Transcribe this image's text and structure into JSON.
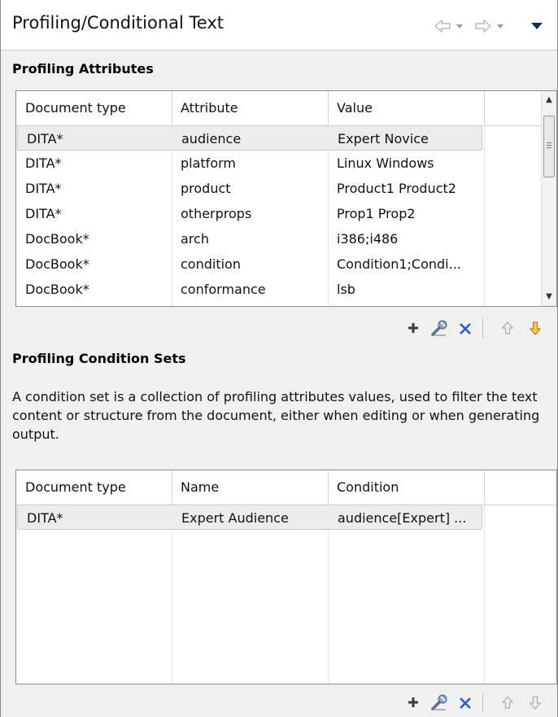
{
  "panel": {
    "title": "Profiling/Conditional Text"
  },
  "profiling_attributes": {
    "section_title": "Profiling Attributes",
    "columns": [
      "Document type",
      "Attribute",
      "Value"
    ],
    "rows": [
      {
        "doc_type": "DITA*",
        "attribute": "audience",
        "value": "Expert Novice",
        "selected": true
      },
      {
        "doc_type": "DITA*",
        "attribute": "platform",
        "value": "Linux Windows"
      },
      {
        "doc_type": "DITA*",
        "attribute": "product",
        "value": "Product1 Product2"
      },
      {
        "doc_type": "DITA*",
        "attribute": "otherprops",
        "value": "Prop1 Prop2"
      },
      {
        "doc_type": "DocBook*",
        "attribute": "arch",
        "value": "i386;i486"
      },
      {
        "doc_type": "DocBook*",
        "attribute": "condition",
        "value": "Condition1;Condi..."
      },
      {
        "doc_type": "DocBook*",
        "attribute": "conformance",
        "value": "lsb"
      }
    ]
  },
  "condition_sets": {
    "section_title": "Profiling Condition Sets",
    "description": "A condition set is a collection of profiling attributes values, used to filter the text content or structure from the document, either when editing or when generating output.",
    "columns": [
      "Document type",
      "Name",
      "Condition"
    ],
    "rows": [
      {
        "doc_type": "DITA*",
        "name": "Expert Audience",
        "condition": "audience[Expert] ...",
        "selected": true
      }
    ]
  },
  "toolbar_icons": [
    "add-icon",
    "edit-icon",
    "remove-icon",
    "move-up-icon",
    "move-down-icon"
  ],
  "colors": {
    "add": "#3a3a3a",
    "remove": "#2a5bd7",
    "move_down_active": "#e6a817",
    "disabled": "#b0b0b0"
  }
}
